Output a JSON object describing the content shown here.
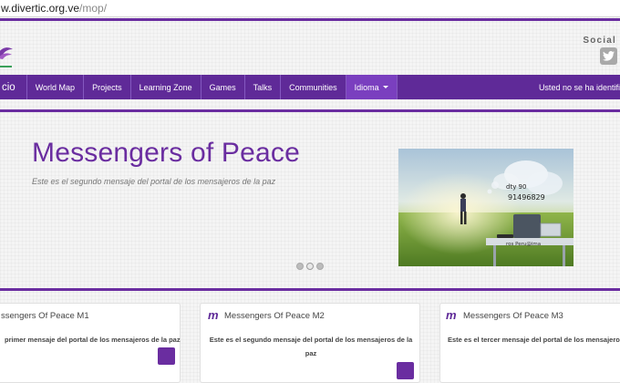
{
  "browser": {
    "url_host": "w.divertic.org.ve",
    "url_path": "/mop/"
  },
  "header": {
    "social_label": "Social"
  },
  "nav": {
    "home_label": "cio",
    "items": [
      "World Map",
      "Projects",
      "Learning Zone",
      "Games",
      "Talks",
      "Communities"
    ],
    "language_label": "Idioma",
    "login_notice": "Usted no se ha identifi"
  },
  "hero": {
    "title": "Messengers of Peace",
    "subtitle": "Este es el segundo mensaje del portal de los mensajeros de la paz",
    "image_caption_1": "dty 90",
    "image_caption_2": "91496829",
    "image_caption_3": "ros Peru@ima",
    "slides_count": 3,
    "active_slide": 2
  },
  "cards": [
    {
      "icon": "m-logo-icon",
      "title": "ssengers Of Peace M1",
      "text_lines": [
        "primer mensaje del portal de los mensajeros de la paz"
      ]
    },
    {
      "icon": "m-logo-icon",
      "title": "Messengers Of Peace M2",
      "text_lines": [
        "Este es el segundo mensaje del portal de los mensajeros de la",
        "paz"
      ]
    },
    {
      "icon": "m-logo-icon",
      "title": "Messengers Of Peace M3",
      "text_lines": [
        "Este es el tercer mensaje del portal de los mensajeros de la"
      ]
    }
  ],
  "card_icon_letter": "m",
  "colors": {
    "brand_purple": "#5f2a98",
    "nav_active": "#7a3fbf"
  }
}
